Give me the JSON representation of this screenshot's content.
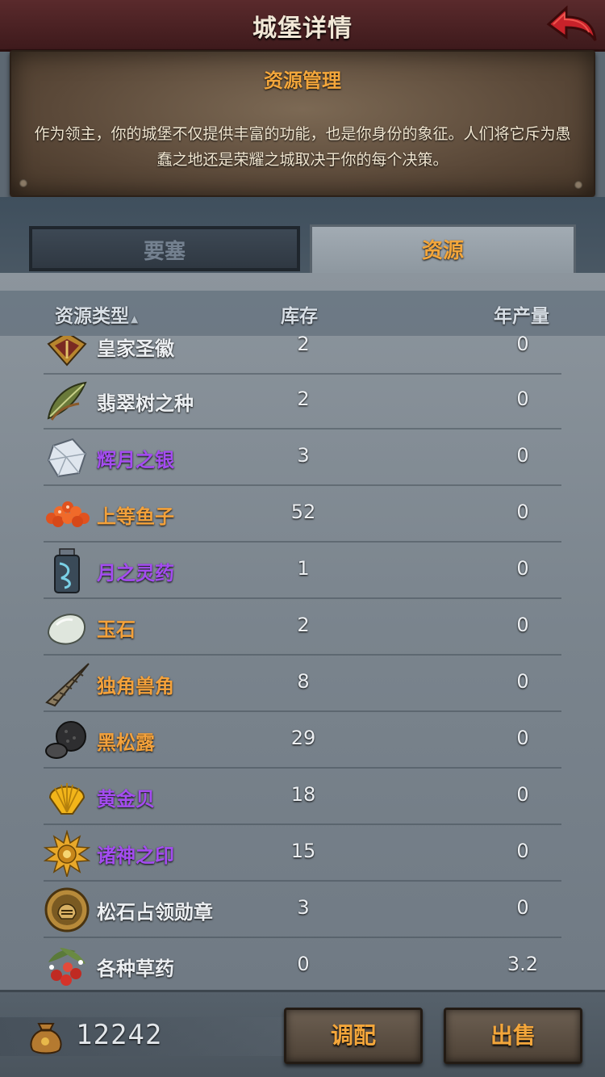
{
  "header": {
    "title": "城堡详情"
  },
  "info": {
    "title": "资源管理",
    "description": "作为领主，你的城堡不仅提供丰富的功能，也是你身份的象征。人们将它斥为愚蠢之地还是荣耀之城取决于你的每个决策。"
  },
  "tabs": [
    {
      "label": "要塞",
      "active": false
    },
    {
      "label": "资源",
      "active": true
    }
  ],
  "columns": {
    "type": "资源类型",
    "stock": "库存",
    "yearly": "年产量"
  },
  "rows": [
    {
      "name": "皇家圣徽",
      "stock": "2",
      "yearly": "0",
      "color": "#eceff2",
      "icon": "royal-crest-icon"
    },
    {
      "name": "翡翠树之种",
      "stock": "2",
      "yearly": "0",
      "color": "#eceff2",
      "icon": "leaf-seed-icon"
    },
    {
      "name": "辉月之银",
      "stock": "3",
      "yearly": "0",
      "color": "#a44cf0",
      "icon": "silver-crystal-icon"
    },
    {
      "name": "上等鱼子",
      "stock": "52",
      "yearly": "0",
      "color": "#f3a13b",
      "icon": "caviar-icon"
    },
    {
      "name": "月之灵药",
      "stock": "1",
      "yearly": "0",
      "color": "#a44cf0",
      "icon": "potion-bottle-icon"
    },
    {
      "name": "玉石",
      "stock": "2",
      "yearly": "0",
      "color": "#f3a13b",
      "icon": "jade-stone-icon"
    },
    {
      "name": "独角兽角",
      "stock": "8",
      "yearly": "0",
      "color": "#f3a13b",
      "icon": "unicorn-horn-icon"
    },
    {
      "name": "黑松露",
      "stock": "29",
      "yearly": "0",
      "color": "#f3a13b",
      "icon": "black-truffle-icon"
    },
    {
      "name": "黄金贝",
      "stock": "18",
      "yearly": "0",
      "color": "#a44cf0",
      "icon": "golden-shell-icon"
    },
    {
      "name": "诸神之印",
      "stock": "15",
      "yearly": "0",
      "color": "#a44cf0",
      "icon": "sun-seal-icon"
    },
    {
      "name": "松石占领勋章",
      "stock": "3",
      "yearly": "0",
      "color": "#eceff2",
      "icon": "helmet-medal-icon"
    },
    {
      "name": "各种草药",
      "stock": "0",
      "yearly": "3.2",
      "color": "#eceff2",
      "icon": "herbs-berries-icon"
    }
  ],
  "footer": {
    "gold_amount": "12242",
    "gold_icon": "gold-sack-icon",
    "allocate_label": "调配",
    "sell_label": "出售"
  },
  "colors": {
    "accent_orange": "#f3a63b",
    "rarity_purple": "#a44cf0",
    "header_red": "#5a2a2c"
  }
}
